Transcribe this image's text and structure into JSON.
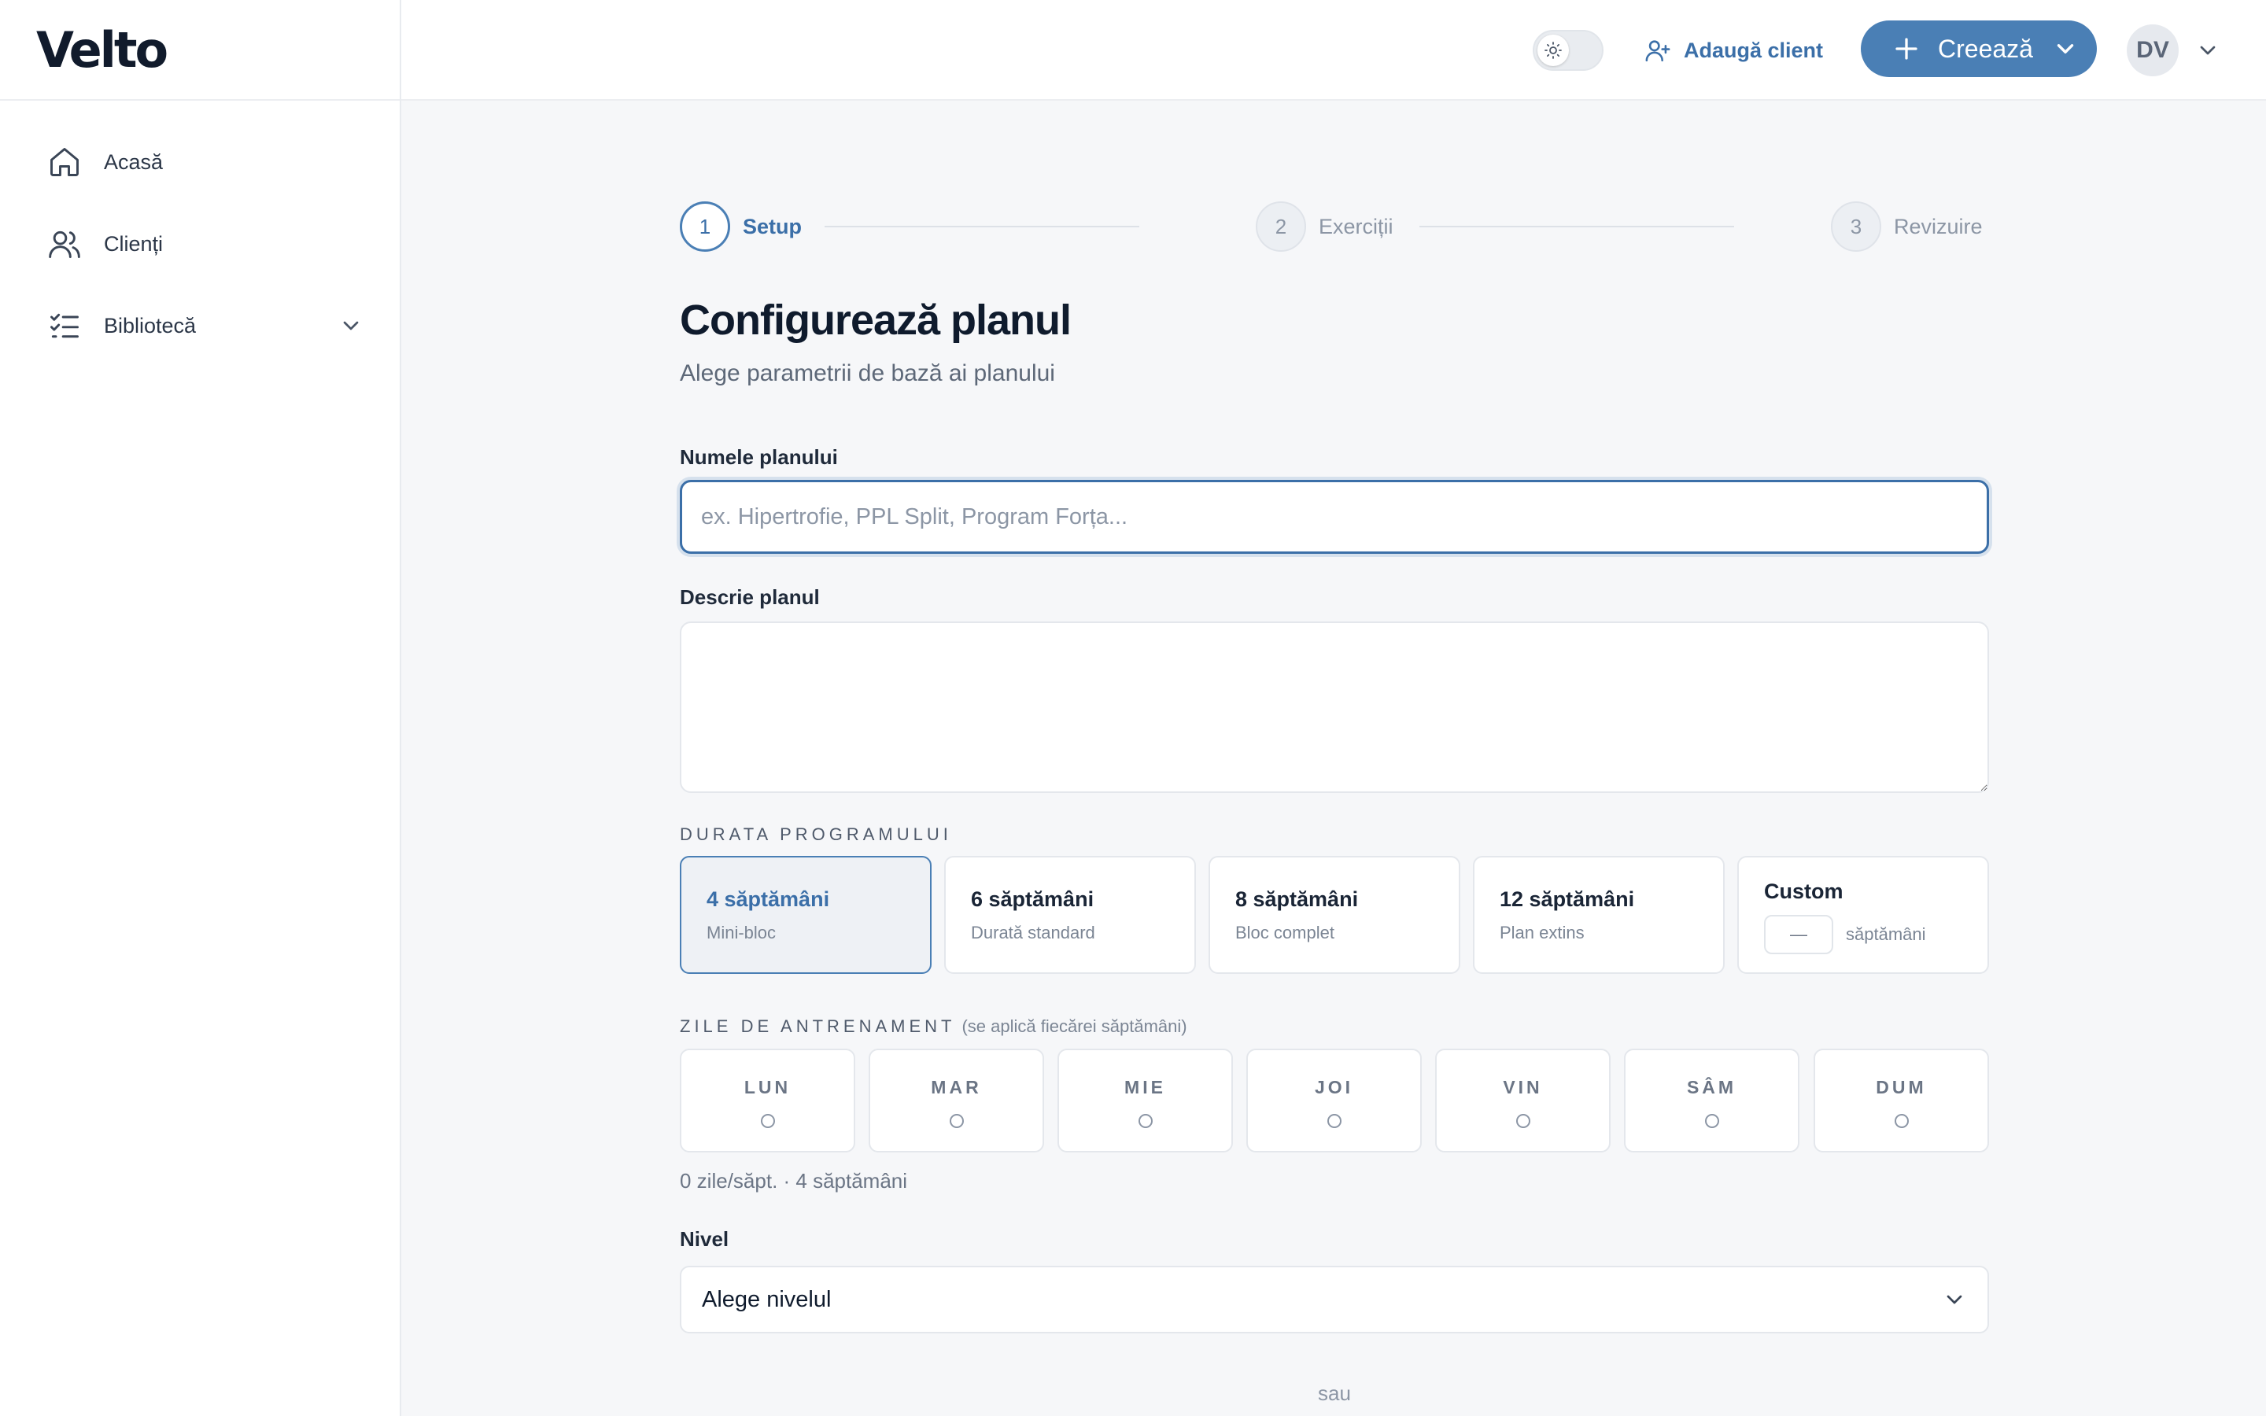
{
  "brand": {
    "name": "Velto"
  },
  "sidebar": {
    "items": [
      {
        "label": "Acasă",
        "icon": "home-icon"
      },
      {
        "label": "Clienți",
        "icon": "users-icon"
      },
      {
        "label": "Bibliotecă",
        "icon": "checklist-icon",
        "expandable": true
      }
    ]
  },
  "header": {
    "theme_toggle_icon": "sun-icon",
    "add_client_label": "Adaugă client",
    "create_label": "Creează",
    "avatar_initials": "DV"
  },
  "stepper": {
    "steps": [
      {
        "number": "1",
        "label": "Setup",
        "state": "active"
      },
      {
        "number": "2",
        "label": "Exerciții",
        "state": "idle"
      },
      {
        "number": "3",
        "label": "Revizuire",
        "state": "idle"
      }
    ]
  },
  "page": {
    "title": "Configurează planul",
    "subtitle": "Alege parametrii de bază ai planului"
  },
  "form": {
    "name_label": "Numele planului",
    "name_placeholder": "ex. Hipertrofie, PPL Split, Program Forța...",
    "name_value": "",
    "description_label": "Descrie planul",
    "description_value": "",
    "duration_label": "DURATA PROGRAMULUI",
    "durations": [
      {
        "title": "4 săptămâni",
        "subtitle": "Mini-bloc",
        "selected": true
      },
      {
        "title": "6 săptămâni",
        "subtitle": "Durată standard",
        "selected": false
      },
      {
        "title": "8 săptămâni",
        "subtitle": "Bloc complet",
        "selected": false
      },
      {
        "title": "12 săptămâni",
        "subtitle": "Plan extins",
        "selected": false
      }
    ],
    "custom_duration": {
      "title": "Custom",
      "value": "—",
      "unit": "săptămâni"
    },
    "days_label": "ZILE DE ANTRENAMENT",
    "days_hint": "(se aplică fiecărei săptămâni)",
    "days": [
      "LUN",
      "MAR",
      "MIE",
      "JOI",
      "VIN",
      "SÂM",
      "DUM"
    ],
    "days_summary": "0 zile/săpt. · 4 săptămâni",
    "level_label": "Nivel",
    "level_value": "Alege nivelul",
    "or_text": "sau"
  },
  "colors": {
    "accent": "#4a7fb5",
    "accent_text": "#3b6fa8",
    "background": "#f6f7f9"
  }
}
